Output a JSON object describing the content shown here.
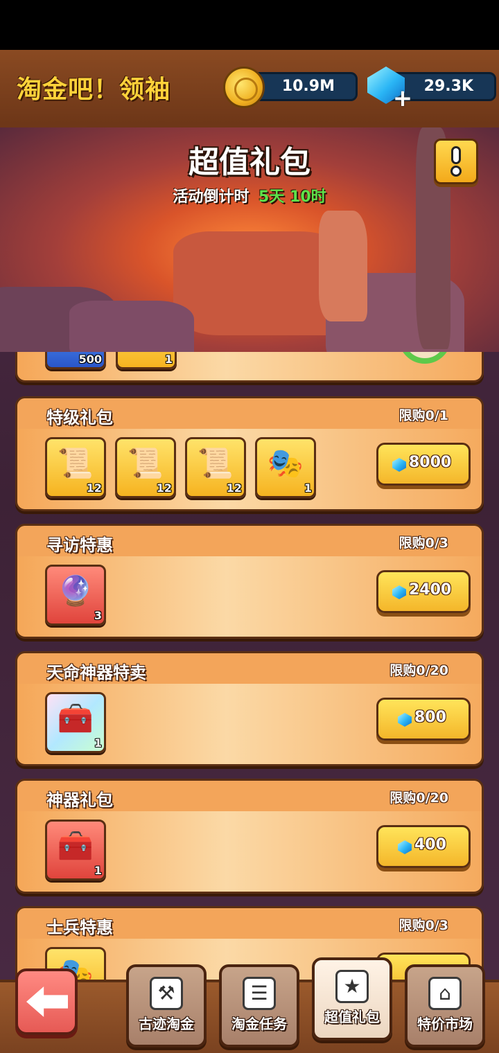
{
  "header": {
    "title": "淘金吧！领袖",
    "gold_amount": "10.9M",
    "gem_amount": "29.3K"
  },
  "banner": {
    "title": "超值礼包",
    "countdown_label": "活动倒计时",
    "countdown_value": "5天 10时"
  },
  "packages": [
    {
      "title": "",
      "limit": "",
      "items": [
        {
          "icon": "blue-gem-stack-icon",
          "qty": "500"
        },
        {
          "icon": "scroll-icon",
          "qty": "1"
        }
      ]
    },
    {
      "title": "特级礼包",
      "limit": "限购0/1",
      "items": [
        {
          "icon": "scroll-icon",
          "qty": "12"
        },
        {
          "icon": "scroll-icon",
          "qty": "12"
        },
        {
          "icon": "scroll-icon",
          "qty": "12"
        },
        {
          "icon": "golden-masks-icon",
          "qty": "1"
        }
      ],
      "price": "8000"
    },
    {
      "title": "寻访特惠",
      "limit": "限购0/3",
      "items": [
        {
          "icon": "purple-scroll-icon",
          "qty": "3"
        }
      ],
      "price": "2400"
    },
    {
      "title": "天命神器特卖",
      "limit": "限购0/20",
      "items": [
        {
          "icon": "rainbow-chest-icon",
          "qty": "1"
        }
      ],
      "price": "800"
    },
    {
      "title": "神器礼包",
      "limit": "限购0/20",
      "items": [
        {
          "icon": "golden-chest-icon",
          "qty": "1"
        }
      ],
      "price": "400"
    },
    {
      "title": "士兵特惠",
      "limit": "限购0/3",
      "items": [
        {
          "icon": "golden-masks-icon",
          "qty": ""
        }
      ]
    }
  ],
  "nav": {
    "tabs": [
      {
        "label": "古迹淘金",
        "icon": "pickaxe-icon"
      },
      {
        "label": "淘金任务",
        "icon": "clipboard-icon"
      },
      {
        "label": "超值礼包",
        "icon": "gift-box-icon",
        "active": true
      },
      {
        "label": "特价市场",
        "icon": "shop-icon"
      }
    ]
  },
  "colors": {
    "gold_text": "#ffd23a",
    "countdown_green": "#5ee24a",
    "card_orange": "#f5a758",
    "button_yellow": "#ffe45a"
  }
}
